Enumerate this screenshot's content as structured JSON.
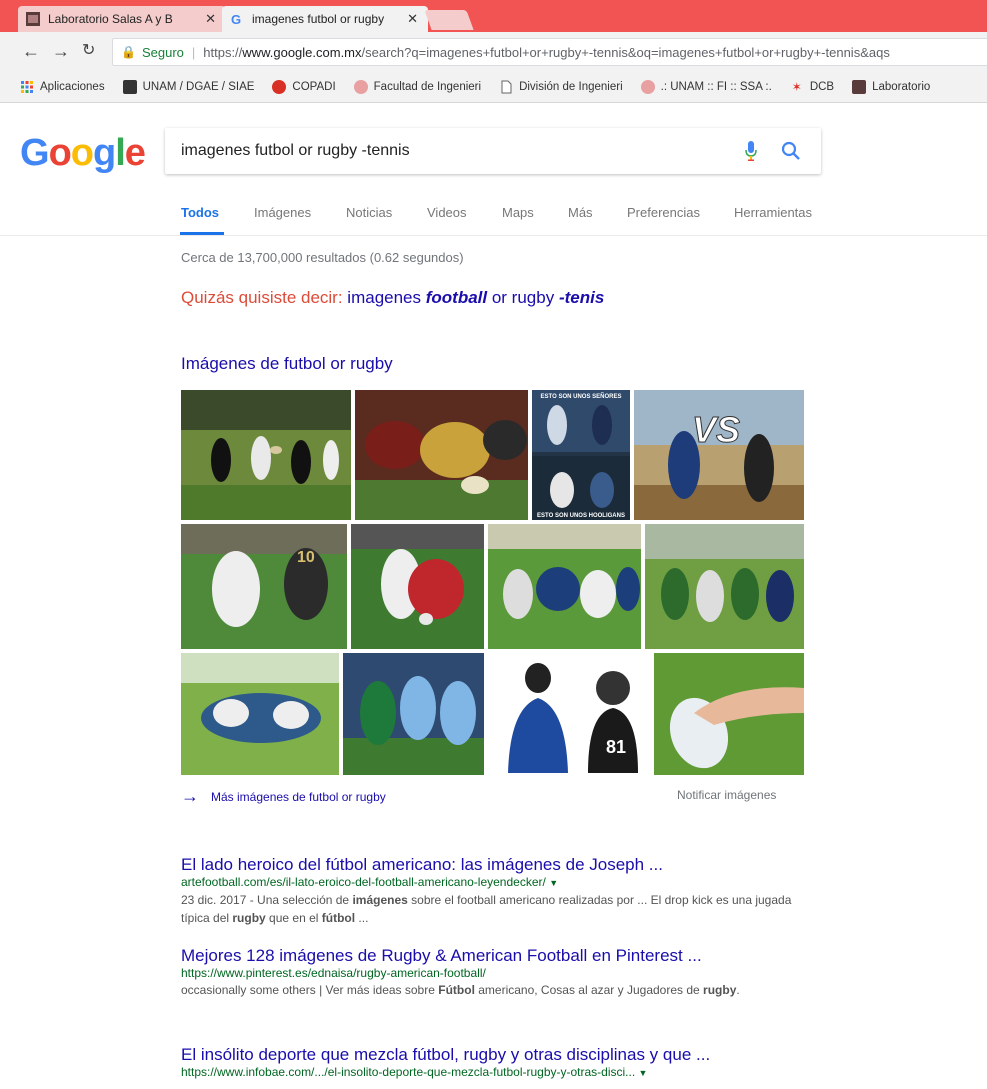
{
  "browser": {
    "tabs": [
      {
        "title": "Laboratorio Salas A y B",
        "active": false
      },
      {
        "title": "imagenes futbol or rugby",
        "active": true
      }
    ],
    "secure_label": "Seguro",
    "url_prefix": "https://",
    "url_host": "www.google.com.mx",
    "url_path": "/search?q=imagenes+futbol+or+rugby+-tennis&oq=imagenes+futbol+or+rugby+-tennis&aqs",
    "bookmarks": [
      {
        "label": "Aplicaciones"
      },
      {
        "label": "UNAM / DGAE / SIAE"
      },
      {
        "label": "COPADI"
      },
      {
        "label": "Facultad de Ingenieri"
      },
      {
        "label": "División de Ingenieri"
      },
      {
        "label": ".: UNAM :: FI :: SSA :."
      },
      {
        "label": "DCB"
      },
      {
        "label": "Laboratorio"
      }
    ]
  },
  "google": {
    "logo": "Google",
    "query": "imagenes futbol or rugby -tennis",
    "tabs": [
      {
        "label": "Todos"
      },
      {
        "label": "Imágenes"
      },
      {
        "label": "Noticias"
      },
      {
        "label": "Videos"
      },
      {
        "label": "Maps"
      },
      {
        "label": "Más"
      },
      {
        "label": "Preferencias"
      },
      {
        "label": "Herramientas"
      }
    ],
    "stats": "Cerca de 13,700,000 resultados (0.62 segundos)",
    "did_you_mean": {
      "prefix": "Quizás quisiste decir: ",
      "plain1": "imagenes ",
      "bold1": "football",
      "plain2": " or rugby ",
      "bold2": "-tenis"
    },
    "images_header": "Imágenes de futbol or rugby",
    "more_images": "Más imágenes de futbol or rugby",
    "report_images": "Notificar imágenes",
    "thumb_text": {
      "top": "ESTO SON UNOS SEÑORES",
      "bottom": "ESTO SON UNOS HOOLIGANS",
      "vs": "VS"
    },
    "results": [
      {
        "title": "El lado heroico del fútbol americano: las imágenes de Joseph ...",
        "url": "artefootball.com/es/il-lato-eroico-del-football-americano-leyendecker/",
        "snippet_a": "23 dic. 2017 - Una selección de ",
        "snippet_b": "imágenes",
        "snippet_c": " sobre el football americano realizadas por ... El drop kick es una jugada típica del ",
        "snippet_d": "rugby",
        "snippet_e": " que en el ",
        "snippet_f": "fútbol",
        "snippet_g": " ..."
      },
      {
        "title": "Mejores 128 imágenes de Rugby & American Football en Pinterest ...",
        "url": "https://www.pinterest.es/ednaisa/rugby-american-football/",
        "snippet_a": "occasionally some others | Ver más ideas sobre ",
        "snippet_b": "Fútbol",
        "snippet_c": " americano, Cosas al azar y Jugadores de ",
        "snippet_d": "rugby",
        "snippet_e": "."
      },
      {
        "title": "El insólito deporte que mezcla fútbol, rugby y otras disciplinas y que ...",
        "url": "https://www.infobae.com/.../el-insolito-deporte-que-mezcla-futbol-rugby-y-otras-disci..."
      }
    ]
  },
  "colors": {
    "chrome_red": "#f25454",
    "link_blue": "#1a0dab",
    "url_green": "#006621",
    "accent_blue": "#1a73e8",
    "did_you_mean_red": "#dd4b39"
  }
}
